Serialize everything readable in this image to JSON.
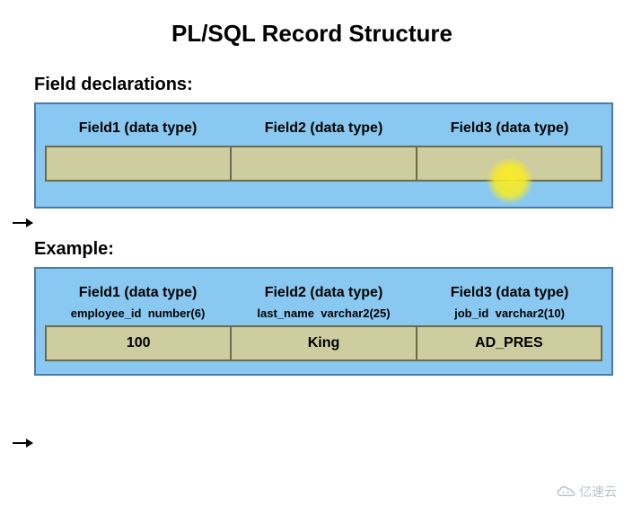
{
  "title": "PL/SQL Record Structure",
  "declarations": {
    "label": "Field declarations:",
    "fields": [
      {
        "header": "Field1 (data type)"
      },
      {
        "header": "Field2 (data type)"
      },
      {
        "header": "Field3 (data type)"
      }
    ]
  },
  "example": {
    "label": "Example:",
    "fields": [
      {
        "header": "Field1 (data type)",
        "name": "employee_id",
        "dtype": "number(6)",
        "value": "100"
      },
      {
        "header": "Field2 (data type)",
        "name": "last_name",
        "dtype": "varchar2(25)",
        "value": "King"
      },
      {
        "header": "Field3 (data type)",
        "name": "job_id",
        "dtype": "varchar2(10)",
        "value": "AD_PRES"
      }
    ]
  },
  "watermark": "亿速云",
  "chart_data": {
    "type": "table",
    "title": "PL/SQL Record Structure",
    "columns": [
      "Field1 (data type)",
      "Field2 (data type)",
      "Field3 (data type)"
    ],
    "subcolumns": [
      {
        "name": "employee_id",
        "dtype": "number(6)"
      },
      {
        "name": "last_name",
        "dtype": "varchar2(25)"
      },
      {
        "name": "job_id",
        "dtype": "varchar2(10)"
      }
    ],
    "rows": [
      {
        "employee_id": 100,
        "last_name": "King",
        "job_id": "AD_PRES"
      }
    ]
  }
}
